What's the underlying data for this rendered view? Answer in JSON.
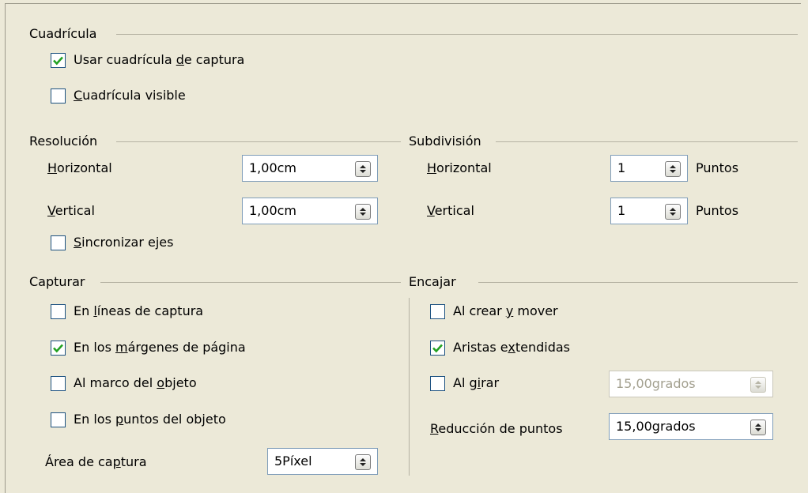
{
  "cuadricula": {
    "title": "Cuadrícula",
    "snap_grid": {
      "pre": "Usar cuadrícula ",
      "key": "d",
      "post": "e captura",
      "checked": true
    },
    "visible_grid": {
      "pre": "",
      "key": "C",
      "post": "uadrícula visible",
      "checked": false
    }
  },
  "resolucion": {
    "title": "Resolución",
    "horizontal": {
      "pre": "",
      "key": "H",
      "post": "orizontal",
      "value": "1,00cm"
    },
    "vertical": {
      "pre": "",
      "key": "V",
      "post": "ertical",
      "value": "1,00cm"
    },
    "sync_axes": {
      "pre": "",
      "key": "S",
      "post": "incronizar ejes",
      "checked": false
    }
  },
  "subdivision": {
    "title": "Subdivisión",
    "horizontal": {
      "pre": "",
      "key": "H",
      "post": "orizontal",
      "value": "1",
      "unit": "Puntos"
    },
    "vertical": {
      "pre": "",
      "key": "V",
      "post": "ertical",
      "value": "1",
      "unit": "Puntos"
    }
  },
  "capturar": {
    "title": "Capturar",
    "snap_lines": {
      "pre": "En ",
      "key": "l",
      "post": "íneas de captura",
      "checked": false
    },
    "page_margins": {
      "pre": "En los ",
      "key": "m",
      "post": "árgenes de página",
      "checked": true
    },
    "object_frame": {
      "pre": "Al marco del ",
      "key": "o",
      "post": "bjeto",
      "checked": false
    },
    "object_points": {
      "pre": "En los ",
      "key": "p",
      "post": "untos del objeto",
      "checked": false
    },
    "snap_range": {
      "pre": "Área de ca",
      "key": "p",
      "post": "tura",
      "value": "5Píxel"
    }
  },
  "encajar": {
    "title": "Encajar",
    "create_move": {
      "pre": "Al crear ",
      "key": "y",
      "post": " mover",
      "checked": false
    },
    "extended_edges": {
      "pre": "Aristas e",
      "key": "x",
      "post": "tendidas",
      "checked": true
    },
    "rotate": {
      "pre": "Al g",
      "key": "i",
      "post": "rar",
      "checked": false,
      "value": "15,00grados"
    },
    "point_reduction": {
      "pre": "",
      "key": "R",
      "post": "educción de puntos",
      "value": "15,00grados"
    }
  },
  "icons": {
    "checkbox_check": "check-icon",
    "spin": "spin-arrows-icon"
  },
  "colors": {
    "background": "#ece9d8",
    "checkbox_border": "#1c5180",
    "check": "#21a121",
    "field_border": "#7f9db9"
  }
}
